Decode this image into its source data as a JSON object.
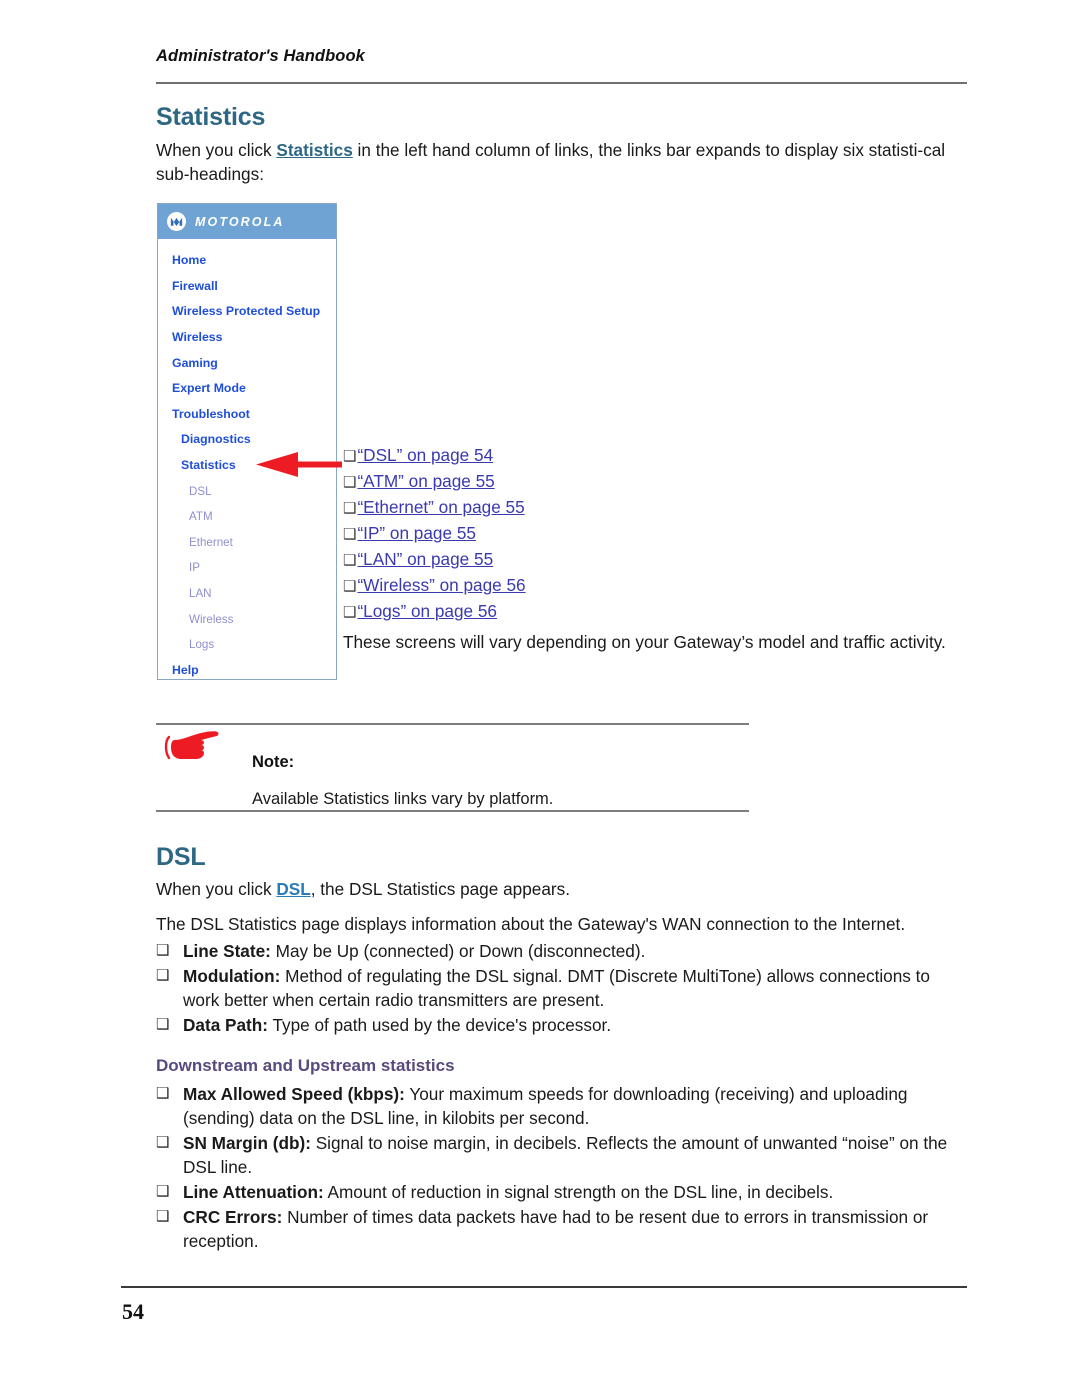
{
  "page": {
    "running_header": "Administrator's Handbook",
    "page_number": "54"
  },
  "statistics_section": {
    "heading": "Statistics",
    "intro_before": "When you click ",
    "intro_link": "Statistics",
    "intro_after": " in the left hand column of links, the links bar expands to display six statisti-cal sub-headings:",
    "closing_paragraph": "These screens will vary depending on your Gateway’s model and traffic activity."
  },
  "nav_panel": {
    "brand": "MOTOROLA",
    "items": [
      {
        "label": "Home",
        "level": 0
      },
      {
        "label": "Firewall",
        "level": 0
      },
      {
        "label": "Wireless Protected Setup",
        "level": 0
      },
      {
        "label": "Wireless",
        "level": 0
      },
      {
        "label": "Gaming",
        "level": 0
      },
      {
        "label": "Expert Mode",
        "level": 0
      },
      {
        "label": "Troubleshoot",
        "level": 0
      },
      {
        "label": "Diagnostics",
        "level": 1
      },
      {
        "label": "Statistics",
        "level": 1
      },
      {
        "label": "DSL",
        "level": 2
      },
      {
        "label": "ATM",
        "level": 2
      },
      {
        "label": "Ethernet",
        "level": 2
      },
      {
        "label": "IP",
        "level": 2
      },
      {
        "label": "LAN",
        "level": 2
      },
      {
        "label": "Wireless",
        "level": 2
      },
      {
        "label": "Logs",
        "level": 2
      },
      {
        "label": "Help",
        "level": 0
      }
    ],
    "colors": {
      "logobar_background": "#6ea3d4",
      "link": "#1f4fd8",
      "sublink": "#8f8fd0",
      "border": "#8aa7c4"
    }
  },
  "annotation": {
    "arrow_color": "#ed1c24",
    "arrow_direction": "left",
    "points_at": "Statistics"
  },
  "cross_references": {
    "bullet_glyph": "❑",
    "items": [
      "“DSL” on page 54",
      "“ATM” on page 55",
      "“Ethernet” on page 55",
      "“IP” on page 55",
      "“LAN” on page 55",
      "“Wireless” on page 56",
      "“Logs” on page 56"
    ]
  },
  "note": {
    "icon": "pointing-hand-icon",
    "icon_color": "#ed1c24",
    "label": "Note:",
    "body": "Available Statistics links vary by platform."
  },
  "dsl_section": {
    "heading": "DSL",
    "para1_before": "When you click ",
    "para1_link": "DSL",
    "para1_after": ", the DSL Statistics page appears.",
    "para2": "The DSL Statistics page displays information about the Gateway's WAN connection to the Internet.",
    "bullets": [
      {
        "term": "Line State:",
        "text": " May be Up (connected) or Down (disconnected)."
      },
      {
        "term": "Modulation:",
        "text": " Method of regulating the DSL signal. DMT (Discrete MultiTone) allows connections to work better when certain radio transmitters are present."
      },
      {
        "term": "Data Path:",
        "text": " Type of path used by the device's processor."
      }
    ]
  },
  "downstream_upstream": {
    "heading": "Downstream and Upstream statistics",
    "heading_color": "#584a7e",
    "bullets": [
      {
        "term": "Max Allowed Speed (kbps):",
        "text": " Your maximum speeds for downloading (receiving) and uploading (sending) data on the DSL line, in kilobits per second."
      },
      {
        "term": "SN Margin (db):",
        "text": " Signal to noise margin, in decibels. Reflects the amount of unwanted “noise” on the DSL line."
      },
      {
        "term": "Line Attenuation:",
        "text": " Amount of reduction in signal strength on the DSL line, in decibels."
      },
      {
        "term": "CRC Errors:",
        "text": " Number of times data packets have had to be resent due to errors in transmission or reception."
      }
    ]
  },
  "theme": {
    "heading_teal": "#2d6783",
    "inline_link_blue": "#2b7bb9",
    "xref_link": "#3a3ab0",
    "body_text": "#1a1a1a"
  }
}
